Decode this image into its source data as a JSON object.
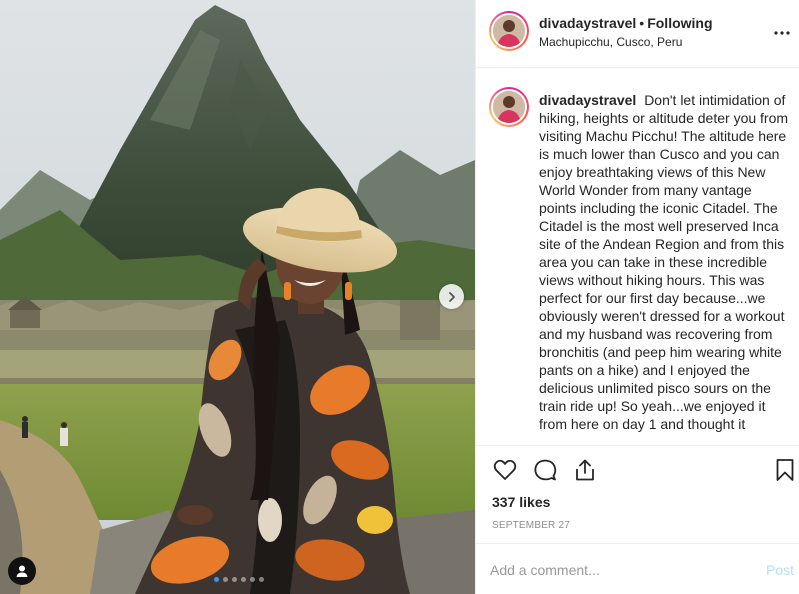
{
  "post": {
    "username": "divadaystravel",
    "separator": "•",
    "follow_status": "Following",
    "location": "Machupicchu, Cusco, Peru",
    "more_label": "•••",
    "caption": "Don't let intimidation of hiking, heights or altitude deter you from visiting Machu Picchu! The altitude here is much lower than Cusco and you can enjoy breathtaking views of this New World Wonder from many vantage points including the iconic Citadel. The Citadel is the most well preserved Inca site of the Andean Region and from this area you can take in these incredible views without hiking hours. This was perfect for our first day because...we obviously weren't dressed for a workout and my husband was recovering from bronchitis (and peep him wearing white pants on a hike) and I enjoyed the delicious unlimited pisco sours on the train ride up! So yeah...we enjoyed it from here on day 1 and thought it",
    "likes": "337 likes",
    "date": "SEPTEMBER 27"
  },
  "comment": {
    "placeholder": "Add a comment...",
    "post_label": "Post"
  },
  "carousel": {
    "count": 6,
    "active_index": 0
  },
  "icons": {
    "like": "heart-icon",
    "comment": "comment-bubble-icon",
    "share": "share-icon",
    "save": "bookmark-icon",
    "next": "chevron-right-icon",
    "tags": "user-tag-icon"
  },
  "colors": {
    "accent_blue": "#3897f0",
    "post_disabled": "#b2dffc",
    "text": "#262626",
    "muted": "#8e8e8e",
    "border": "#efefef"
  }
}
